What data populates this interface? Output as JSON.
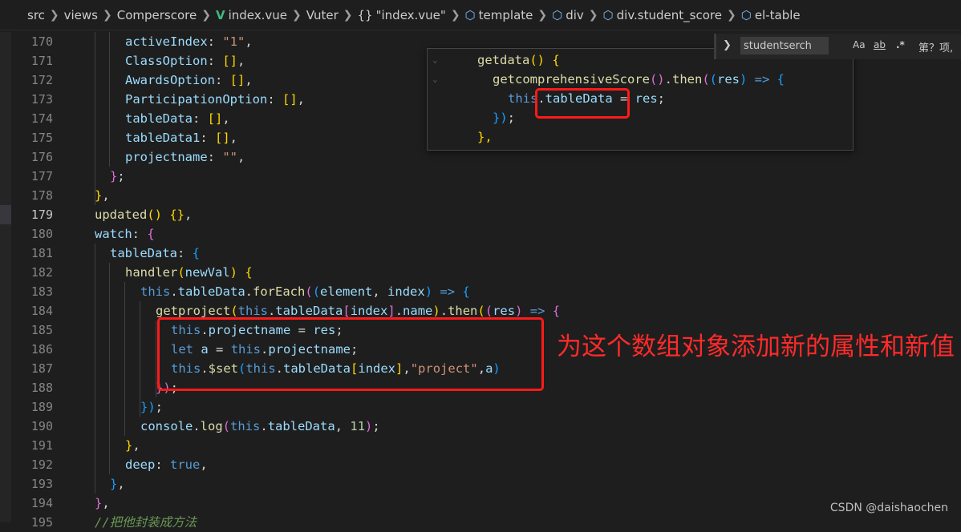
{
  "breadcrumb": {
    "items": [
      "src",
      "views",
      "Comperscore",
      "index.vue",
      "Vuter",
      "\"index.vue\"",
      "template",
      "div",
      "div.student_score",
      "el-table"
    ]
  },
  "icons": {
    "vue_file": "vue-icon",
    "object": "braces-icon",
    "element": "cube-icon",
    "chevron": "chevron-right-icon"
  },
  "colors": {
    "background": "#1e1e1e",
    "keyword": "#569cd6",
    "property": "#9cdcfe",
    "string": "#ce9178",
    "function": "#dcdcaa",
    "annotation": "#ff2a2a"
  },
  "code": {
    "line_numbers": [
      "170",
      "171",
      "172",
      "173",
      "174",
      "175",
      "176",
      "177",
      "178",
      "179",
      "180",
      "181",
      "182",
      "183",
      "184",
      "185",
      "186",
      "187",
      "188",
      "189",
      "190",
      "191",
      "192",
      "193",
      "194",
      "195"
    ],
    "current_line": "179",
    "l170": {
      "t1": "activeIndex",
      "t2": ": ",
      "t3": "\"1\"",
      "t4": ","
    },
    "l171": {
      "t1": "ClassOption",
      "t2": ": ",
      "t3": "[]",
      "t4": ","
    },
    "l172": {
      "t1": "AwardsOption",
      "t2": ": ",
      "t3": "[]",
      "t4": ","
    },
    "l173": {
      "t1": "ParticipationOption",
      "t2": ": ",
      "t3": "[]",
      "t4": ","
    },
    "l174": {
      "t1": "tableData",
      "t2": ": ",
      "t3": "[]",
      "t4": ","
    },
    "l175": {
      "t1": "tableData1",
      "t2": ": ",
      "t3": "[]",
      "t4": ","
    },
    "l176": {
      "t1": "projectname",
      "t2": ": ",
      "t3": "\"\"",
      "t4": ","
    },
    "l177": {
      "t1": "}",
      "t2": ";"
    },
    "l178": {
      "t1": "}",
      "t2": ","
    },
    "l179": {
      "t1": "updated",
      "t2": "()",
      "t3": " ",
      "t4": "{}",
      "t5": ","
    },
    "l180": {
      "t1": "watch",
      "t2": ": ",
      "t3": "{"
    },
    "l181": {
      "t1": "tableData",
      "t2": ": ",
      "t3": "{"
    },
    "l182": {
      "t1": "handler",
      "t2": "(",
      "t3": "newVal",
      "t4": ")",
      "t5": " ",
      "t6": "{"
    },
    "l183": {
      "t1": "this",
      "t2": ".",
      "t3": "tableData",
      "t4": ".",
      "t5": "forEach",
      "t6": "(",
      "t7": "(",
      "t8": "element",
      "t9": ", ",
      "t10": "index",
      "t11": ")",
      "t12": " => ",
      "t13": "{"
    },
    "l184": {
      "t1": "getproject",
      "t2": "(",
      "t3": "this",
      "t4": ".",
      "t5": "tableData",
      "t6": "[",
      "t7": "index",
      "t8": "]",
      "t9": ".",
      "t10": "name",
      "t11": ")",
      "t12": ".",
      "t13": "then",
      "t14": "(",
      "t15": "(",
      "t16": "res",
      "t17": ")",
      "t18": " => ",
      "t19": "{"
    },
    "l185": {
      "t1": "this",
      "t2": ".",
      "t3": "projectname",
      "t4": " = ",
      "t5": "res",
      "t6": ";"
    },
    "l186": {
      "t1": "let",
      "t2": " ",
      "t3": "a",
      "t4": " = ",
      "t5": "this",
      "t6": ".",
      "t7": "projectname",
      "t8": ";"
    },
    "l187": {
      "t1": "this",
      "t2": ".",
      "t3": "$set",
      "t4": "(",
      "t5": "this",
      "t6": ".",
      "t7": "tableData",
      "t8": "[",
      "t9": "index",
      "t10": "]",
      "t11": ",",
      "t12": "\"project\"",
      "t13": ",",
      "t14": "a",
      "t15": ")"
    },
    "l188": {
      "t1": "})",
      "t2": ";"
    },
    "l189": {
      "t1": "})",
      "t2": ";"
    },
    "l190": {
      "t1": "console",
      "t2": ".",
      "t3": "log",
      "t4": "(",
      "t5": "this",
      "t6": ".",
      "t7": "tableData",
      "t8": ", ",
      "t9": "11",
      "t10": ")",
      "t11": ";"
    },
    "l191": {
      "t1": "}",
      "t2": ","
    },
    "l192": {
      "t1": "deep",
      "t2": ": ",
      "t3": "true",
      "t4": ","
    },
    "l193": {
      "t1": "}",
      "t2": ","
    },
    "l194": {
      "t1": "}",
      "t2": ","
    },
    "l195": {
      "t1": "//把他封装成方法"
    }
  },
  "peek": {
    "p1": {
      "t1": "getdata",
      "t2": "()",
      "t3": " ",
      "t4": "{"
    },
    "p2": {
      "t1": "getcomprehensiveScore",
      "t2": "()",
      "t3": ".",
      "t4": "then",
      "t5": "(",
      "t6": "(",
      "t7": "res",
      "t8": ")",
      "t9": " => ",
      "t10": "{"
    },
    "p3": {
      "t1": "this",
      "t2": ".",
      "t3": "tableData",
      "t4": " = ",
      "t5": "res",
      "t6": ";"
    },
    "p4": {
      "t1": "})",
      "t2": ";"
    },
    "p5": {
      "t1": "},"
    }
  },
  "find": {
    "value": "studentserch",
    "match_case": "Aa",
    "whole_word": "ab",
    "regex": ".*",
    "count": "第？项,"
  },
  "annotation": {
    "text": "为这个数组对象添加新的属性和新值"
  },
  "watermark": "CSDN @daishaochen"
}
